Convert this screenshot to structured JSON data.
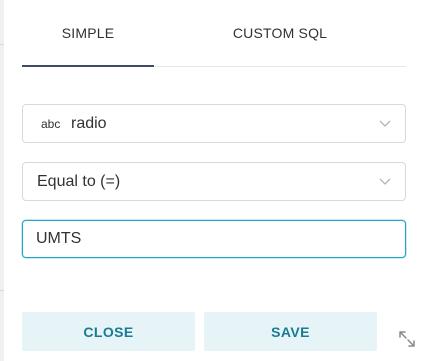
{
  "tabs": [
    {
      "label": "SIMPLE",
      "active": true
    },
    {
      "label": "CUSTOM SQL",
      "active": false
    }
  ],
  "column_select": {
    "type_tag": "abc",
    "value": "radio"
  },
  "operator_select": {
    "value": "Equal to (=)"
  },
  "comparator": {
    "value": "UMTS"
  },
  "buttons": {
    "close_label": "CLOSE",
    "save_label": "SAVE"
  },
  "colors": {
    "accent": "#20a7c9",
    "button_bg": "#e6f4f8",
    "button_text": "#1b7a94",
    "active_tab_underline": "#3f4a66"
  },
  "icons": {
    "select_arrow": "chevron-down-icon",
    "resize_handle": "resize-icon"
  }
}
